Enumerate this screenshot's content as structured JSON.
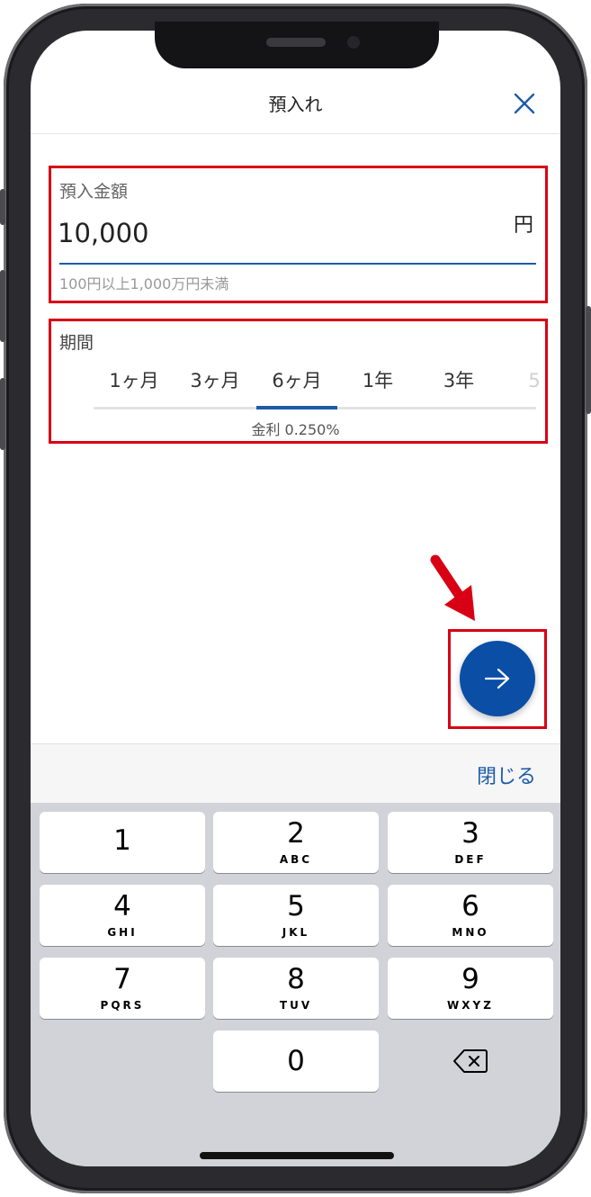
{
  "header": {
    "title": "預入れ"
  },
  "amount": {
    "label": "預入金額",
    "value": "10,000",
    "unit": "円",
    "hint": "100円以上1,000万円未満"
  },
  "term": {
    "label": "期間",
    "tabs": [
      "1ヶ月",
      "3ヶ月",
      "6ヶ月",
      "1年",
      "3年",
      "5"
    ],
    "selected": "6ヶ月",
    "interest": "金利 0.250%"
  },
  "keyboard": {
    "close_label": "閉じる",
    "keys": [
      {
        "digit": "1",
        "letters": ""
      },
      {
        "digit": "2",
        "letters": "ABC"
      },
      {
        "digit": "3",
        "letters": "DEF"
      },
      {
        "digit": "4",
        "letters": "GHI"
      },
      {
        "digit": "5",
        "letters": "JKL"
      },
      {
        "digit": "6",
        "letters": "MNO"
      },
      {
        "digit": "7",
        "letters": "PQRS"
      },
      {
        "digit": "8",
        "letters": "TUV"
      },
      {
        "digit": "9",
        "letters": "WXYZ"
      },
      {
        "digit": "0",
        "letters": ""
      }
    ]
  },
  "icons": {
    "close": "close-icon",
    "next": "arrow-right-icon",
    "backspace": "backspace-icon",
    "annotation": "red-arrow-icon"
  },
  "colors": {
    "accent": "#1e5ba6",
    "next_button": "#0a4ea6",
    "annotation": "#d80014"
  }
}
